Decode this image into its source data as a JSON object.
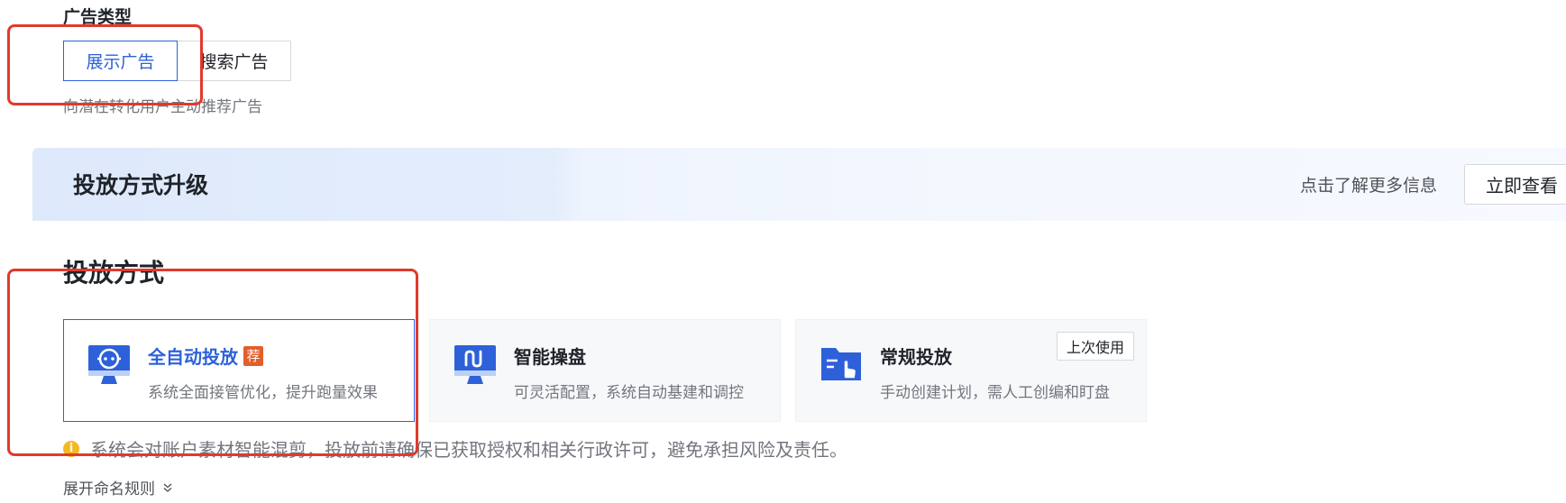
{
  "ad_type": {
    "title": "广告类型",
    "options": [
      {
        "label": "展示广告",
        "active": true
      },
      {
        "label": "搜索广告",
        "active": false
      }
    ],
    "description": "向潜在转化用户主动推荐广告"
  },
  "banner": {
    "title": "投放方式升级",
    "hint": "点击了解更多信息",
    "button_label": "立即查看"
  },
  "delivery": {
    "title": "投放方式",
    "cards": [
      {
        "title": "全自动投放",
        "badge": "荐",
        "description": "系统全面接管优化，提升跑量效果",
        "selected": true,
        "icon": "robot-monitor-icon"
      },
      {
        "title": "智能操盘",
        "description": "可灵活配置，系统自动基建和调控",
        "selected": false,
        "icon": "wave-monitor-icon"
      },
      {
        "title": "常规投放",
        "description": "手动创建计划，需人工创编和盯盘",
        "selected": false,
        "tag": "上次使用",
        "icon": "folder-hand-icon"
      }
    ]
  },
  "notice": {
    "icon": "info-icon",
    "text": "系统会对账户素材智能混剪，投放前请确保已获取授权和相关行政许可，避免承担风险及责任。"
  },
  "expand": {
    "label": "展开命名规则",
    "icon": "double-chevron-down-icon"
  },
  "colors": {
    "accent": "#2e61d9",
    "badge": "#e35e2a",
    "annotation": "#e03a2c",
    "info": "#f6b821"
  }
}
